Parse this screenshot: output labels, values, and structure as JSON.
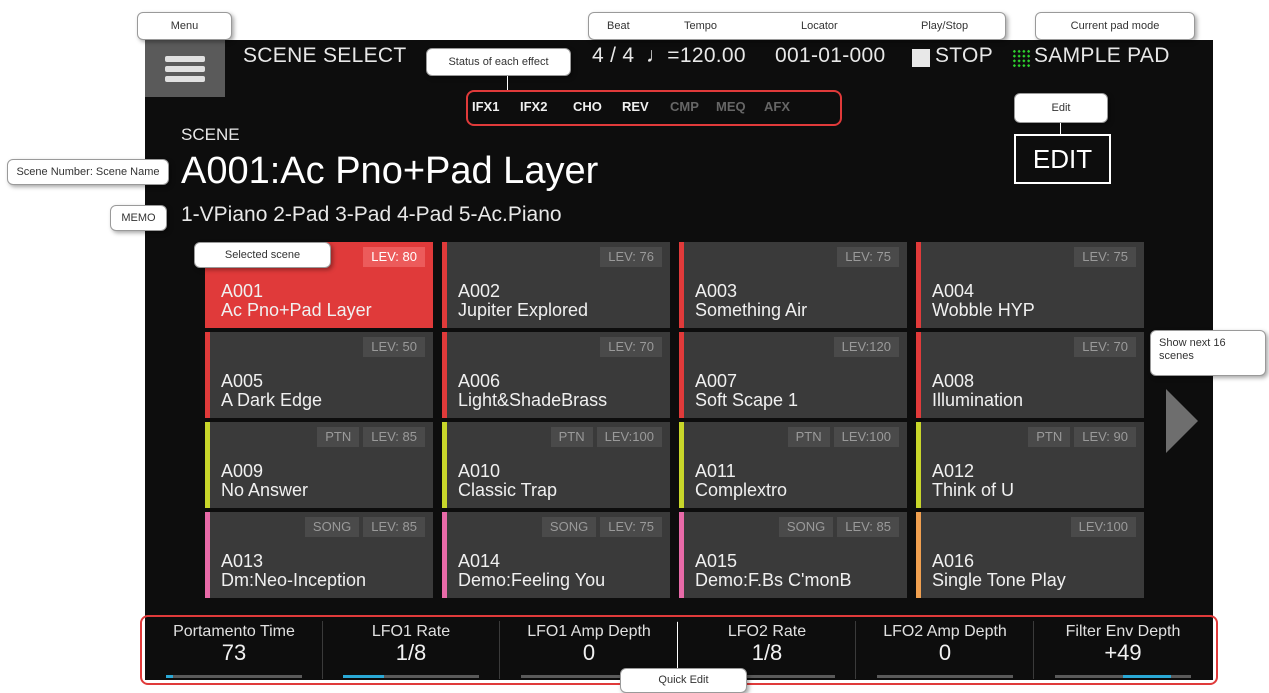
{
  "header": {
    "title": "SCENE SELECT",
    "beat": "4 / 4",
    "tempo": "♩=120.00",
    "locator": "001-01-000",
    "play_state": "STOP",
    "pad_mode": "SAMPLE PAD"
  },
  "effects": [
    {
      "label": "IFX1",
      "active": true
    },
    {
      "label": "IFX2",
      "active": true
    },
    {
      "label": "CHO",
      "active": true
    },
    {
      "label": "REV",
      "active": true
    },
    {
      "label": "CMP",
      "active": false
    },
    {
      "label": "MEQ",
      "active": false
    },
    {
      "label": "AFX",
      "active": false
    }
  ],
  "scene": {
    "label": "SCENE",
    "title": "A001:Ac Pno+Pad Layer",
    "memo": "1-VPiano 2-Pad 3-Pad 4-Pad 5-Ac.Piano"
  },
  "edit_label": "EDIT",
  "tiles": [
    {
      "num": "A001",
      "name": "Ac Pno+Pad Layer",
      "lev": "LEV: 80",
      "tag": "",
      "accent": "#e03a3a",
      "selected": true
    },
    {
      "num": "A002",
      "name": "Jupiter Explored",
      "lev": "LEV: 76",
      "tag": "",
      "accent": "#e03a3a",
      "selected": false
    },
    {
      "num": "A003",
      "name": "Something Air",
      "lev": "LEV: 75",
      "tag": "",
      "accent": "#e03a3a",
      "selected": false
    },
    {
      "num": "A004",
      "name": "Wobble HYP",
      "lev": "LEV: 75",
      "tag": "",
      "accent": "#e03a3a",
      "selected": false
    },
    {
      "num": "A005",
      "name": "A Dark Edge",
      "lev": "LEV: 50",
      "tag": "",
      "accent": "#e03a3a",
      "selected": false
    },
    {
      "num": "A006",
      "name": "Light&ShadeBrass",
      "lev": "LEV: 70",
      "tag": "",
      "accent": "#e03a3a",
      "selected": false
    },
    {
      "num": "A007",
      "name": "Soft Scape 1",
      "lev": "LEV:120",
      "tag": "",
      "accent": "#e03a3a",
      "selected": false
    },
    {
      "num": "A008",
      "name": "Illumination",
      "lev": "LEV: 70",
      "tag": "",
      "accent": "#e03a3a",
      "selected": false
    },
    {
      "num": "A009",
      "name": "No Answer",
      "lev": "LEV: 85",
      "tag": "PTN",
      "accent": "#c8d62a",
      "selected": false
    },
    {
      "num": "A010",
      "name": "Classic Trap",
      "lev": "LEV:100",
      "tag": "PTN",
      "accent": "#c8d62a",
      "selected": false
    },
    {
      "num": "A011",
      "name": "Complextro",
      "lev": "LEV:100",
      "tag": "PTN",
      "accent": "#c8d62a",
      "selected": false
    },
    {
      "num": "A012",
      "name": "Think of U",
      "lev": "LEV: 90",
      "tag": "PTN",
      "accent": "#c8d62a",
      "selected": false
    },
    {
      "num": "A013",
      "name": "Dm:Neo-Inception",
      "lev": "LEV: 85",
      "tag": "SONG",
      "accent": "#e86aa8",
      "selected": false
    },
    {
      "num": "A014",
      "name": "Demo:Feeling You",
      "lev": "LEV: 75",
      "tag": "SONG",
      "accent": "#e86aa8",
      "selected": false
    },
    {
      "num": "A015",
      "name": "Demo:F.Bs C'monB",
      "lev": "LEV: 85",
      "tag": "SONG",
      "accent": "#e86aa8",
      "selected": false
    },
    {
      "num": "A016",
      "name": "Single Tone Play",
      "lev": "LEV:100",
      "tag": "",
      "accent": "#f0a050",
      "selected": false
    }
  ],
  "quick_edit": [
    {
      "name": "Portamento Time",
      "value": "73",
      "fill_from": 0.0,
      "fill_to": 0.05
    },
    {
      "name": "LFO1 Rate",
      "value": "1/8",
      "fill_from": 0.0,
      "fill_to": 0.3
    },
    {
      "name": "LFO1 Amp Depth",
      "value": "0",
      "fill_from": 0.0,
      "fill_to": 0.0
    },
    {
      "name": "LFO2 Rate",
      "value": "1/8",
      "fill_from": 0.0,
      "fill_to": 0.0
    },
    {
      "name": "LFO2 Amp Depth",
      "value": "0",
      "fill_from": 0.0,
      "fill_to": 0.0
    },
    {
      "name": "Filter Env Depth",
      "value": "+49",
      "fill_from": 0.5,
      "fill_to": 0.85
    }
  ],
  "callouts": {
    "menu": "Menu",
    "beat": "Beat",
    "tempo": "Tempo",
    "locator": "Locator",
    "play_stop": "Play/Stop",
    "pad_mode": "Current pad mode",
    "effects": "Status of each effect",
    "edit": "Edit",
    "scene_name": "Scene Number: Scene Name",
    "memo": "MEMO",
    "selected": "Selected scene",
    "next": "Show next 16 scenes",
    "quick_edit": "Quick Edit"
  },
  "colors": {
    "accent_red": "#e03a3a",
    "pattern_yellow": "#c8d62a",
    "song_pink": "#e86aa8",
    "single_orange": "#f0a050",
    "pad_green": "#2ed12e",
    "bar_blue": "#2aa9d6"
  }
}
